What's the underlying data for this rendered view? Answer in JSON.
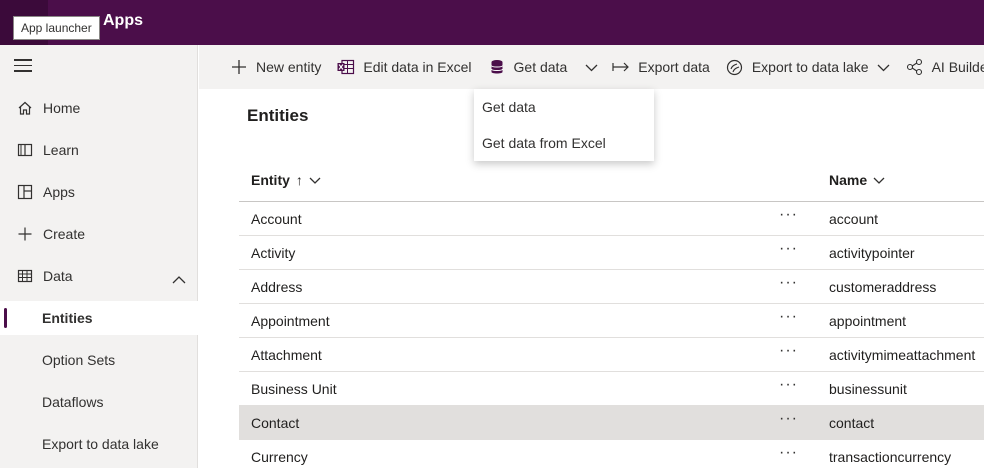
{
  "topbar": {
    "title": "Apps",
    "tooltip": "App launcher"
  },
  "sidebar": {
    "items": [
      {
        "label": "Home",
        "icon": "home-icon"
      },
      {
        "label": "Learn",
        "icon": "book-icon"
      },
      {
        "label": "Apps",
        "icon": "apps-icon"
      },
      {
        "label": "Create",
        "icon": "plus-icon"
      },
      {
        "label": "Data",
        "icon": "table-icon"
      },
      {
        "label": "Entities"
      },
      {
        "label": "Option Sets"
      },
      {
        "label": "Dataflows"
      },
      {
        "label": "Export to data lake"
      }
    ]
  },
  "commands": {
    "new_entity": "New entity",
    "edit_excel": "Edit data in Excel",
    "get_data": "Get data",
    "export_data": "Export data",
    "export_lake": "Export to data lake",
    "ai_builder": "AI Builder"
  },
  "dropdown": {
    "options": [
      "Get data",
      "Get data from Excel"
    ]
  },
  "main": {
    "title": "Entities",
    "columns": {
      "entity": "Entity",
      "name": "Name",
      "sort": "↑"
    },
    "rows": [
      {
        "entity": "Account",
        "name": "account"
      },
      {
        "entity": "Activity",
        "name": "activitypointer"
      },
      {
        "entity": "Address",
        "name": "customeraddress"
      },
      {
        "entity": "Appointment",
        "name": "appointment"
      },
      {
        "entity": "Attachment",
        "name": "activitymimeattachment"
      },
      {
        "entity": "Business Unit",
        "name": "businessunit"
      },
      {
        "entity": "Contact",
        "name": "contact"
      },
      {
        "entity": "Currency",
        "name": "transactioncurrency"
      }
    ],
    "more_glyph": "···"
  },
  "colors": {
    "brand": "#4b0e4a",
    "selected_row": "#e1dfdd",
    "sidebar_bg": "#f3f2f1"
  }
}
